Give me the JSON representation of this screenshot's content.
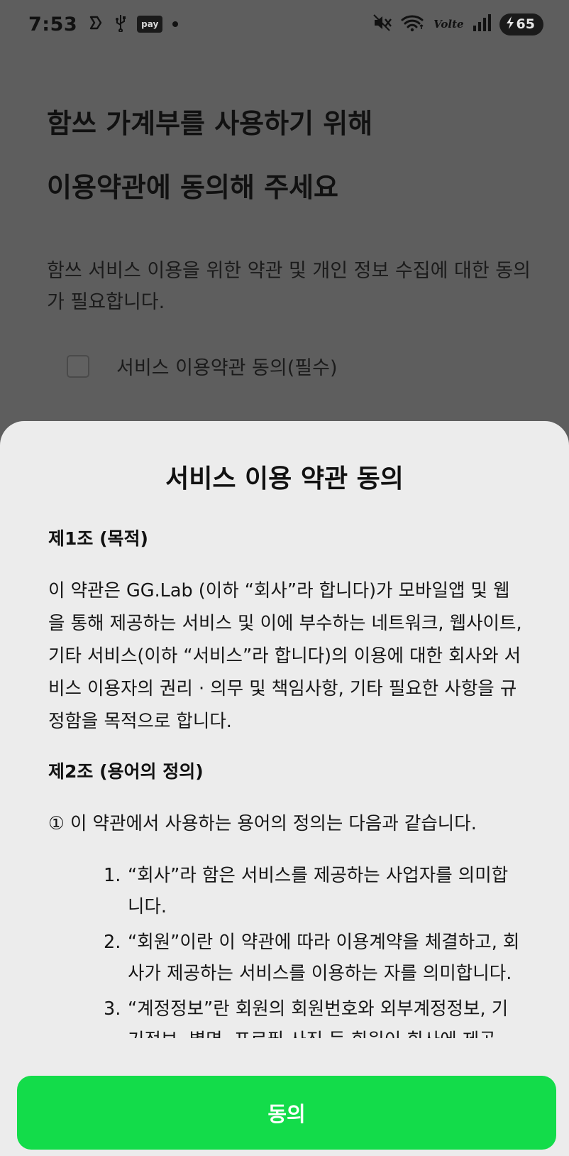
{
  "status_bar": {
    "time": "7:53",
    "pay_label": "pay",
    "network_label": "Volte",
    "battery_level": "65",
    "icons": [
      "shield-icon",
      "usb-icon",
      "pay-icon",
      "dot-icon",
      "mute-icon",
      "wifi-icon",
      "signal-icon",
      "charging-icon"
    ]
  },
  "background": {
    "headline_line1": "함쓰 가계부를 사용하기 위해",
    "headline_line2": "이용약관에 동의해 주세요",
    "subtext": "함쓰 서비스 이용을 위한 약관 및 개인 정보 수집에 대한 동의가 필요합니다.",
    "consent_label": "서비스 이용약관 동의(필수)",
    "consent_checked": false
  },
  "sheet": {
    "title": "서비스 이용 약관 동의",
    "article1_title": "제1조 (목적)",
    "article1_body": "이 약관은 GG.Lab (이하 “회사”라 합니다)가 모바일앱 및 웹을 통해 제공하는 서비스 및 이에 부수하는 네트워크, 웹사이트, 기타 서비스(이하 “서비스”라 합니다)의 이용에 대한 회사와 서비스 이용자의 권리 · 의무 및 책임사항, 기타 필요한 사항을 규정함을 목적으로 합니다.",
    "article2_title": "제2조 (용어의 정의)",
    "article2_intro": "① 이 약관에서 사용하는 용어의 정의는 다음과 같습니다.",
    "definitions": [
      {
        "num": "1.",
        "text": "“회사”라 함은 서비스를 제공하는 사업자를 의미합니다."
      },
      {
        "num": "2.",
        "text": "“회원”이란 이 약관에 따라 이용계약을 체결하고, 회사가 제공하는 서비스를 이용하는 자를 의미합니다."
      },
      {
        "num": "3.",
        "text": "“계정정보”란 회원의 회원번호와 외부계정정보, 기기정보, 별명, 프로필 사진 등 회원이 회사에 제공"
      }
    ],
    "agree_button": "동의",
    "accent_color": "#13dc4a"
  }
}
